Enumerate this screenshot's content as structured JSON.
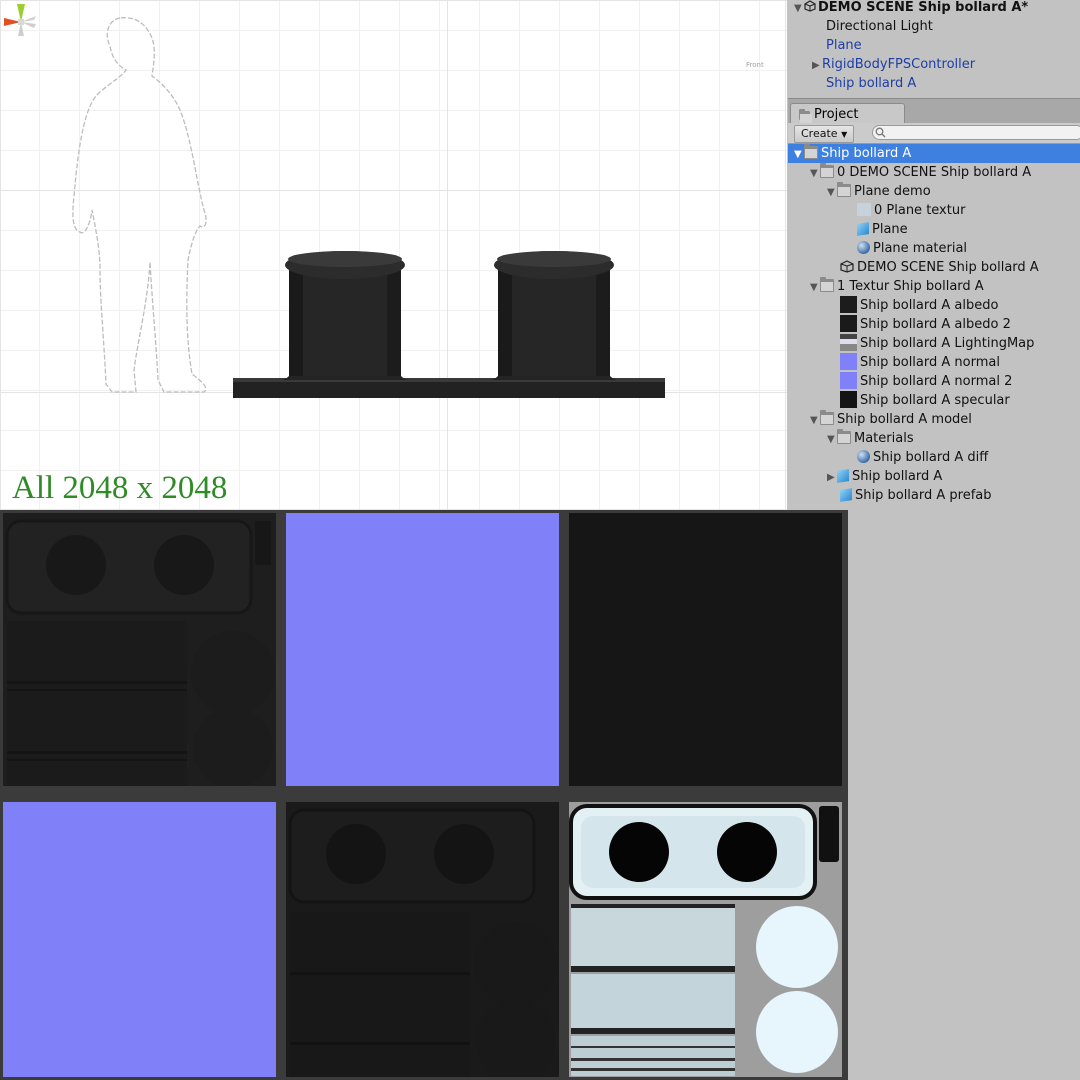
{
  "scene": {
    "resolution_label": "All 2048 x 2048",
    "gizmo_label": "Front"
  },
  "hierarchy": {
    "items": [
      {
        "label": "DEMO SCENE Ship bollard A*",
        "style": "scene-root"
      },
      {
        "label": "Directional Light",
        "style": "normal"
      },
      {
        "label": "Plane",
        "style": "prefab"
      },
      {
        "label": "RigidBodyFPSController",
        "style": "prefab"
      },
      {
        "label": "Ship bollard A",
        "style": "prefab"
      }
    ]
  },
  "project": {
    "tab_label": "Project",
    "create_label": "Create",
    "search_placeholder": "",
    "tree": [
      {
        "label": "Ship bollard A",
        "icon": "folder-icon",
        "selected": true
      },
      {
        "label": "0 DEMO SCENE Ship bollard A",
        "icon": "folder-icon"
      },
      {
        "label": "Plane demo",
        "icon": "folder-icon"
      },
      {
        "label": "0 Plane textur",
        "icon": "texture-icon"
      },
      {
        "label": "Plane",
        "icon": "mesh-icon"
      },
      {
        "label": "Plane material",
        "icon": "material-icon"
      },
      {
        "label": "DEMO SCENE Ship bollard A",
        "icon": "unity-scene-icon"
      },
      {
        "label": "1 Textur Ship bollard A",
        "icon": "folder-icon"
      },
      {
        "label": "Ship bollard A albedo",
        "icon": "texture-icon"
      },
      {
        "label": "Ship bollard A albedo 2",
        "icon": "texture-icon"
      },
      {
        "label": "Ship bollard A LightingMap",
        "icon": "texture-icon"
      },
      {
        "label": "Ship bollard A normal",
        "icon": "texture-icon"
      },
      {
        "label": "Ship bollard A normal 2",
        "icon": "texture-icon"
      },
      {
        "label": "Ship bollard A specular",
        "icon": "texture-icon"
      },
      {
        "label": "Ship bollard A  model",
        "icon": "folder-icon"
      },
      {
        "label": "Materials",
        "icon": "folder-icon"
      },
      {
        "label": "Ship bollard A diff",
        "icon": "material-icon"
      },
      {
        "label": "Ship bollard A",
        "icon": "model-icon"
      },
      {
        "label": "Ship bollard A prefab",
        "icon": "prefab-icon"
      }
    ]
  },
  "colors": {
    "selection": "#3d80df",
    "prefab_text": "#1d3fa4",
    "normal_map": "#8080f8",
    "resolution_label": "#2e8b25",
    "panel_bg": "#c2c2c2"
  }
}
